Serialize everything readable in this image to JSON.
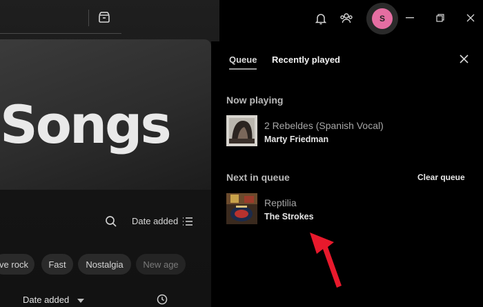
{
  "topbar": {
    "avatar_initial": "S"
  },
  "main": {
    "page_title": "Songs",
    "sort_label": "Date added",
    "chips": [
      "ve rock",
      "Fast",
      "Nostalgia",
      "New age"
    ],
    "column_date_label": "Date added"
  },
  "queue": {
    "tabs": [
      "Queue",
      "Recently played"
    ],
    "now_playing_title": "Now playing",
    "now_playing": {
      "title": "2 Rebeldes (Spanish Vocal)",
      "artist": "Marty Friedman"
    },
    "next_title": "Next in queue",
    "clear_label": "Clear queue",
    "next": [
      {
        "title": "Reptilia",
        "artist": "The Strokes"
      }
    ]
  },
  "colors": {
    "avatar": "#e56ea2",
    "annotation_arrow": "#e8192c"
  }
}
